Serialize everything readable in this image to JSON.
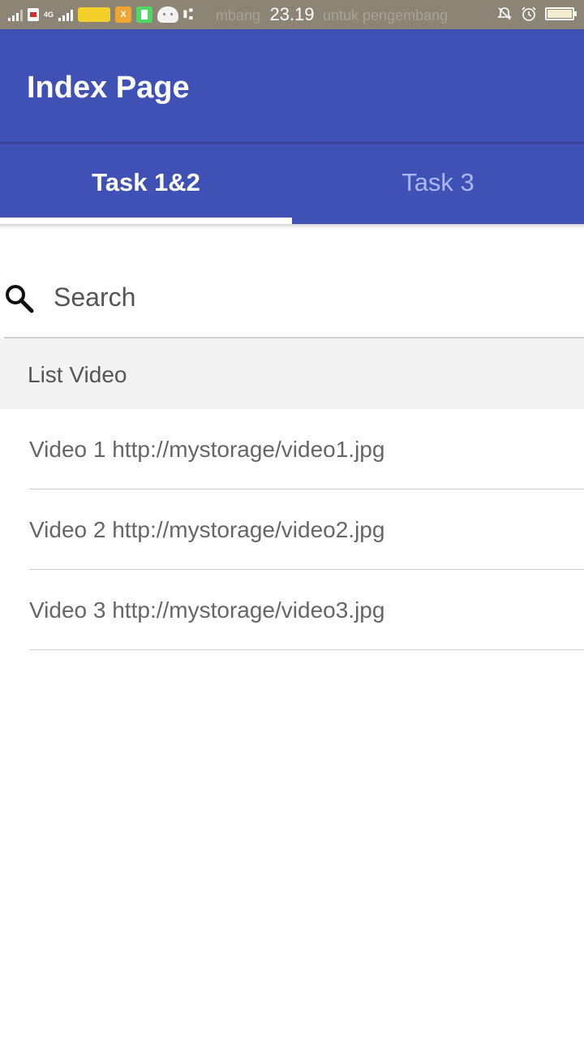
{
  "status_bar": {
    "network": "4G",
    "time": "23.19",
    "ghost_left": "mbang",
    "ghost_right": "untuk pengembang",
    "icons": [
      "signal-icon",
      "sim-icon",
      "signal-icon",
      "indosat-icon",
      "app-icon",
      "battery-saver-icon",
      "android-icon",
      "usb-icon",
      "notification-off-icon",
      "alarm-icon",
      "battery-icon"
    ]
  },
  "app_bar": {
    "title": "Index Page"
  },
  "tabs": [
    {
      "label": "Task 1&2",
      "active": true
    },
    {
      "label": "Task 3",
      "active": false
    }
  ],
  "search": {
    "placeholder": "Search",
    "value": ""
  },
  "section": {
    "title": "List Video"
  },
  "videos": [
    {
      "label": "Video 1 http://mystorage/video1.jpg"
    },
    {
      "label": "Video 2 http://mystorage/video2.jpg"
    },
    {
      "label": "Video 3 http://mystorage/video3.jpg"
    }
  ],
  "colors": {
    "primary": "#3f51b5",
    "status_bar": "#8c8474",
    "tab_inactive": "#aab8f0",
    "section_bg": "#f3f3f3"
  }
}
